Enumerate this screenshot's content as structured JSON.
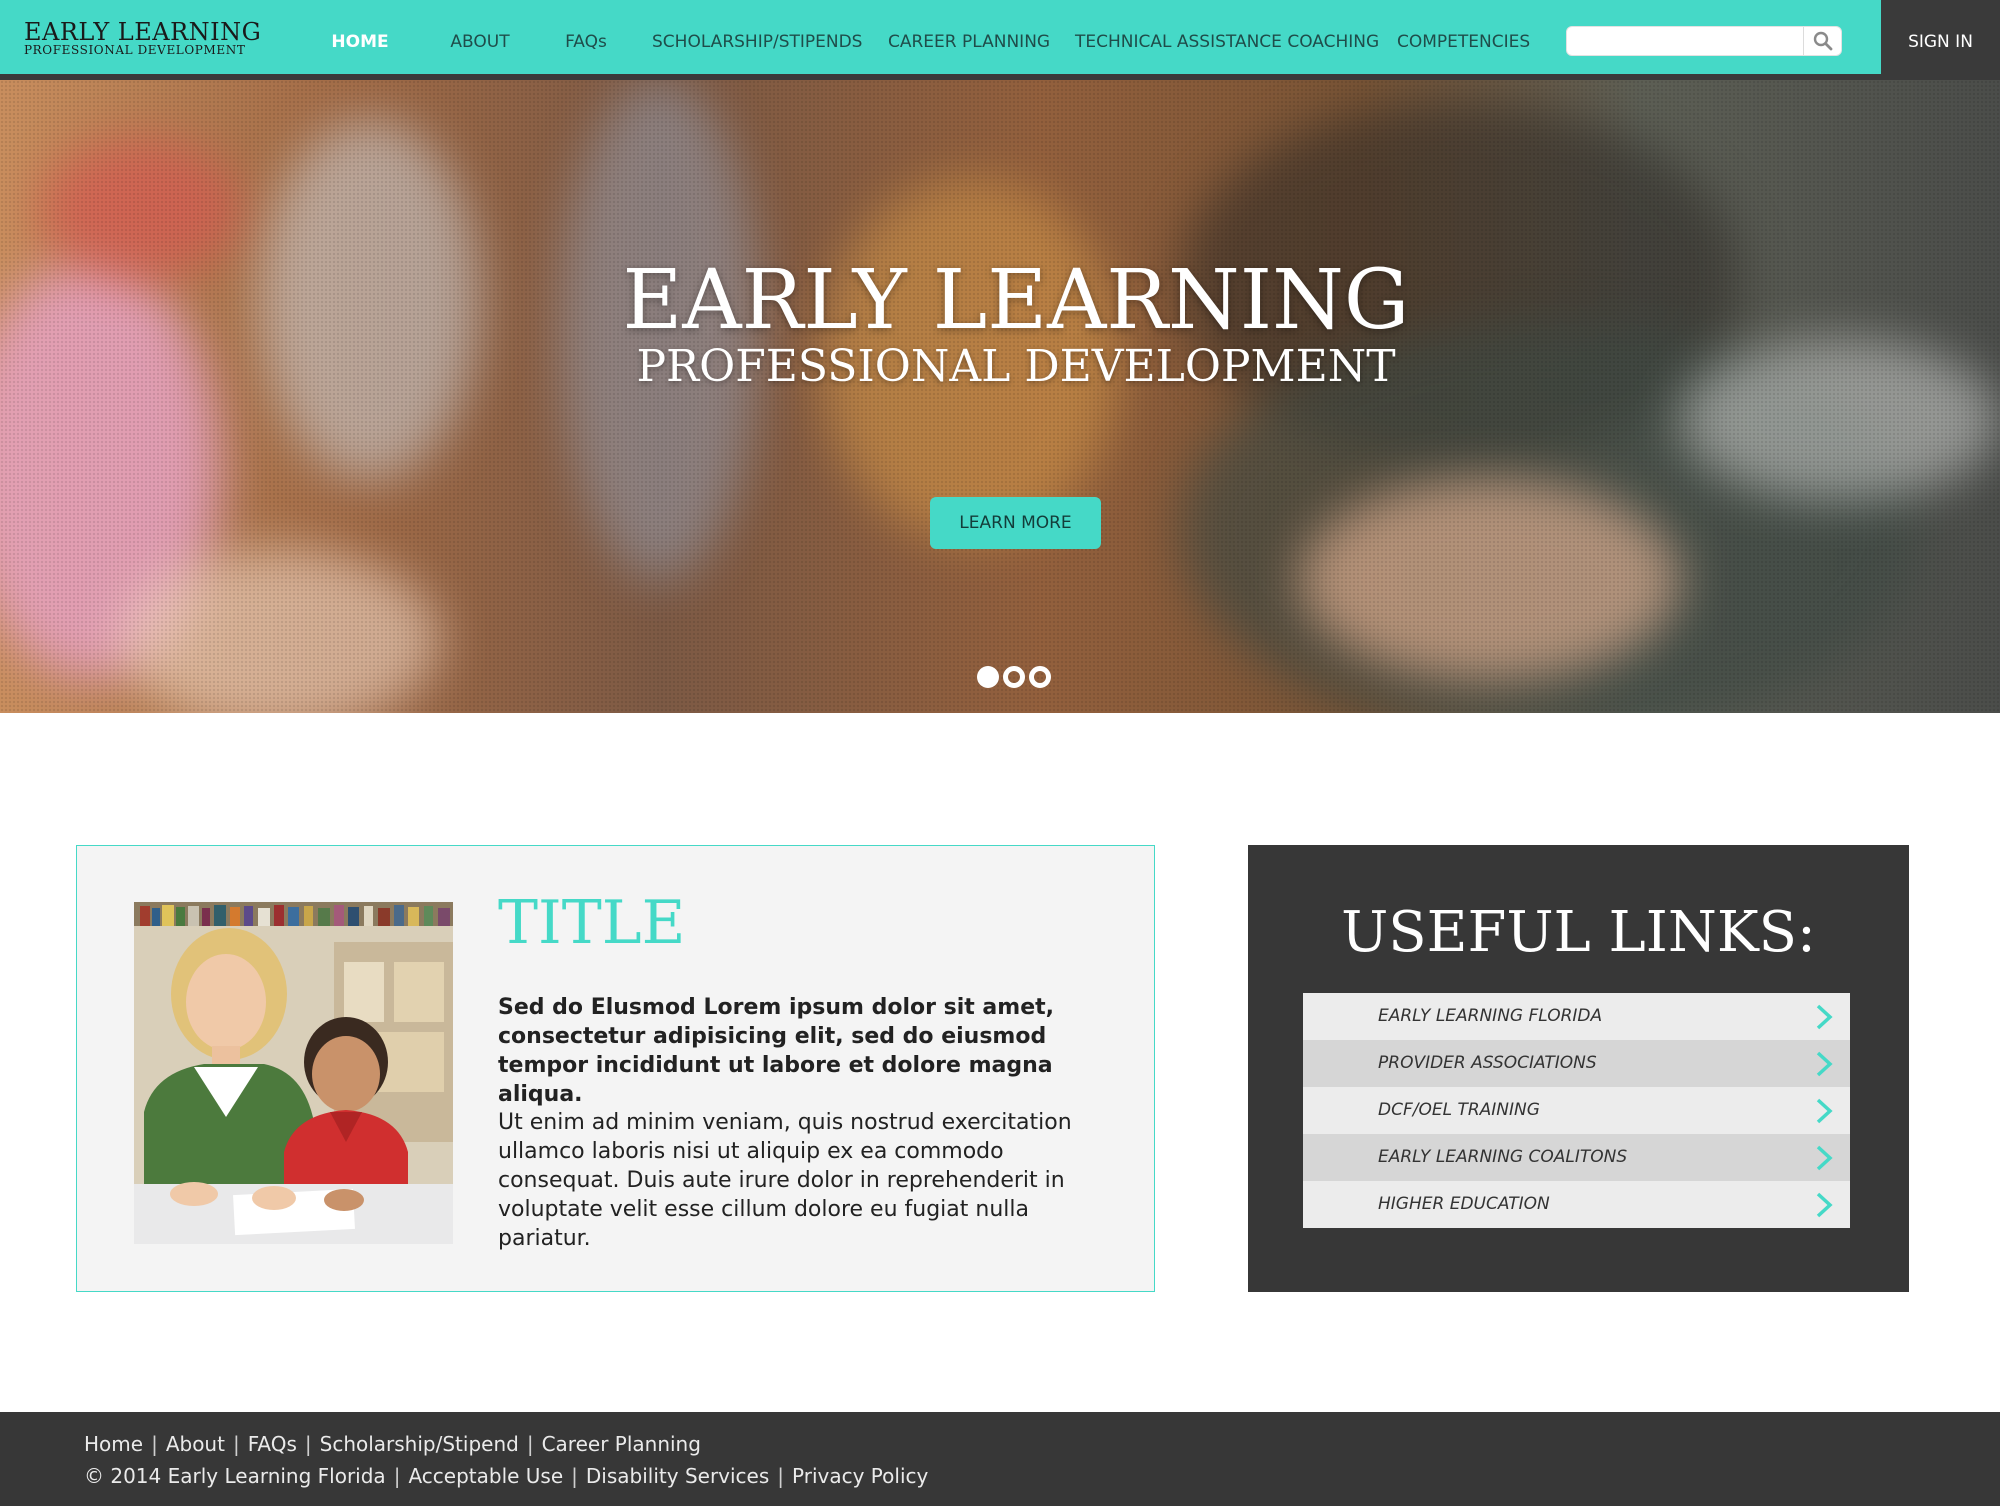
{
  "logo": {
    "line1": "EARLY LEARNING",
    "line2": "PROFESSIONAL DEVELOPMENT"
  },
  "nav": {
    "items": [
      {
        "label": "HOME"
      },
      {
        "label": "ABOUT"
      },
      {
        "label": "FAQs"
      },
      {
        "label": "SCHOLARSHIP/STIPENDS"
      },
      {
        "label": "CAREER PLANNING"
      },
      {
        "label": "TECHNICAL ASSISTANCE COACHING"
      },
      {
        "label": "COMPETENCIES"
      }
    ],
    "active": "HOME",
    "sign_in": "SIGN IN"
  },
  "search": {
    "value": "",
    "placeholder": "",
    "icon": "search-icon"
  },
  "hero": {
    "title": "EARLY LEARNING",
    "subtitle": "PROFESSIONAL DEVELOPMENT",
    "button": "LEARN MORE",
    "slides": 3,
    "active_slide": 1
  },
  "card": {
    "title": "TITLE",
    "lead": "Sed do Elusmod Lorem ipsum dolor sit amet, consectetur adipisicing elit, sed do eiusmod tempor incididunt ut labore et dolore magna aliqua.",
    "body": "Ut enim ad minim veniam, quis nostrud exercitation ullamco laboris nisi ut aliquip ex ea commodo consequat. Duis aute irure dolor in reprehenderit in voluptate velit esse cillum dolore eu fugiat nulla pariatur."
  },
  "useful_links": {
    "title": "USEFUL LINKS:",
    "items": [
      {
        "label": "EARLY LEARNING  FLORIDA"
      },
      {
        "label": "PROVIDER ASSOCIATIONS"
      },
      {
        "label": "DCF/OEL TRAINING"
      },
      {
        "label": "EARLY LEARNING COALITONS"
      },
      {
        "label": "HIGHER EDUCATION"
      }
    ]
  },
  "footer": {
    "row1": [
      "Home",
      "About",
      "FAQs",
      "Scholarship/Stipend",
      "Career Planning"
    ],
    "row2": [
      "© 2014 Early Learning Florida",
      "Acceptable Use",
      "Disability Services",
      "Privacy Policy"
    ],
    "separator": "|"
  },
  "colors": {
    "accent": "#45d9c7",
    "dark": "#373737",
    "header_dark": "#3a3a3a"
  }
}
